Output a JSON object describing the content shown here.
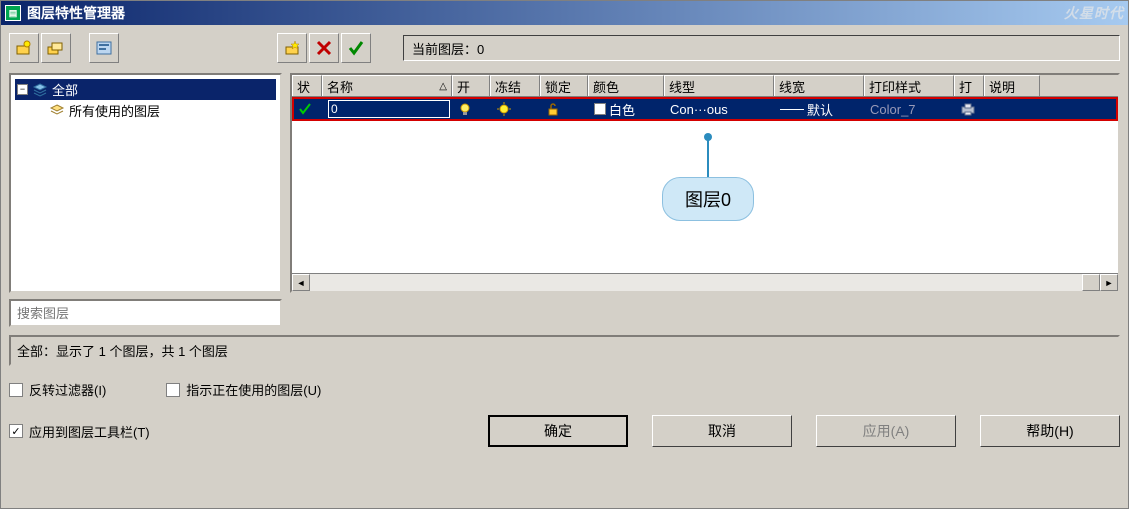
{
  "titlebar": {
    "title": "图层特性管理器",
    "watermark": "火星时代"
  },
  "toolbar": {
    "current_layer_label": "当前图层：0"
  },
  "tree": {
    "root_label": "全部",
    "child_label": "所有使用的图层"
  },
  "grid": {
    "headers": {
      "status": "状",
      "name": "名称",
      "on": "开",
      "freeze": "冻结",
      "lock": "锁定",
      "color": "颜色",
      "linetype": "线型",
      "lineweight": "线宽",
      "plot_style": "打印样式",
      "plot": "打",
      "desc": "说明"
    },
    "rows": [
      {
        "status": "current",
        "name": "0",
        "on": true,
        "freeze": false,
        "lock": false,
        "color_name": "白色",
        "color_hex": "#ffffff",
        "linetype": "Con···ous",
        "lineweight": "默认",
        "plot_style": "Color_7",
        "plot": true,
        "desc": ""
      }
    ]
  },
  "callout": {
    "label": "图层0"
  },
  "search": {
    "placeholder": "搜索图层"
  },
  "status_line": "全部：显示了 1 个图层，共 1 个图层",
  "checks": {
    "invert": "反转过滤器(I)",
    "indicate_used": "指示正在使用的图层(U)",
    "apply_toolbar": "应用到图层工具栏(T)",
    "invert_val": false,
    "indicate_used_val": false,
    "apply_toolbar_val": true
  },
  "buttons": {
    "ok": "确定",
    "cancel": "取消",
    "apply": "应用(A)",
    "help": "帮助(H)"
  }
}
